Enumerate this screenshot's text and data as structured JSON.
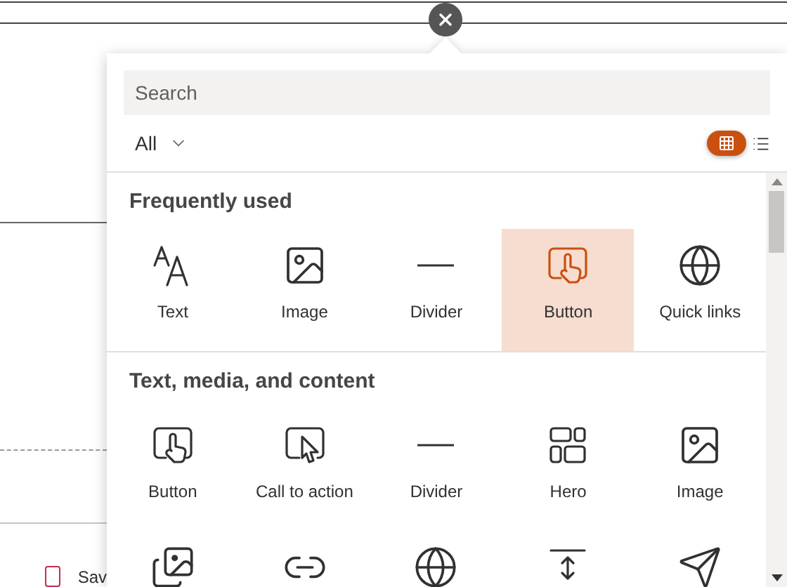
{
  "search": {
    "placeholder": "Search"
  },
  "filter": {
    "label": "All"
  },
  "view_toggle": [
    {
      "kind": "grid",
      "selected": true
    },
    {
      "kind": "list",
      "selected": false
    }
  ],
  "sections": [
    {
      "title": "Frequently used",
      "items": [
        {
          "kind": "text",
          "label": "Text",
          "selected": false
        },
        {
          "kind": "image",
          "label": "Image",
          "selected": false
        },
        {
          "kind": "divider",
          "label": "Divider",
          "selected": false
        },
        {
          "kind": "button",
          "label": "Button",
          "selected": true
        },
        {
          "kind": "globe",
          "label": "Quick links",
          "selected": false
        }
      ]
    },
    {
      "title": "Text, media, and content",
      "items": [
        {
          "kind": "button",
          "label": "Button",
          "selected": false
        },
        {
          "kind": "cta",
          "label": "Call to action",
          "selected": false
        },
        {
          "kind": "divider",
          "label": "Divider",
          "selected": false
        },
        {
          "kind": "hero",
          "label": "Hero",
          "selected": false
        },
        {
          "kind": "image",
          "label": "Image",
          "selected": false
        },
        {
          "kind": "gallery",
          "selected": false
        },
        {
          "kind": "link",
          "selected": false
        },
        {
          "kind": "globe",
          "selected": false
        },
        {
          "kind": "spacer",
          "selected": false
        },
        {
          "kind": "send",
          "selected": false
        }
      ]
    }
  ],
  "background": {
    "checkbox": {
      "checked": false
    },
    "label": "Sav"
  }
}
